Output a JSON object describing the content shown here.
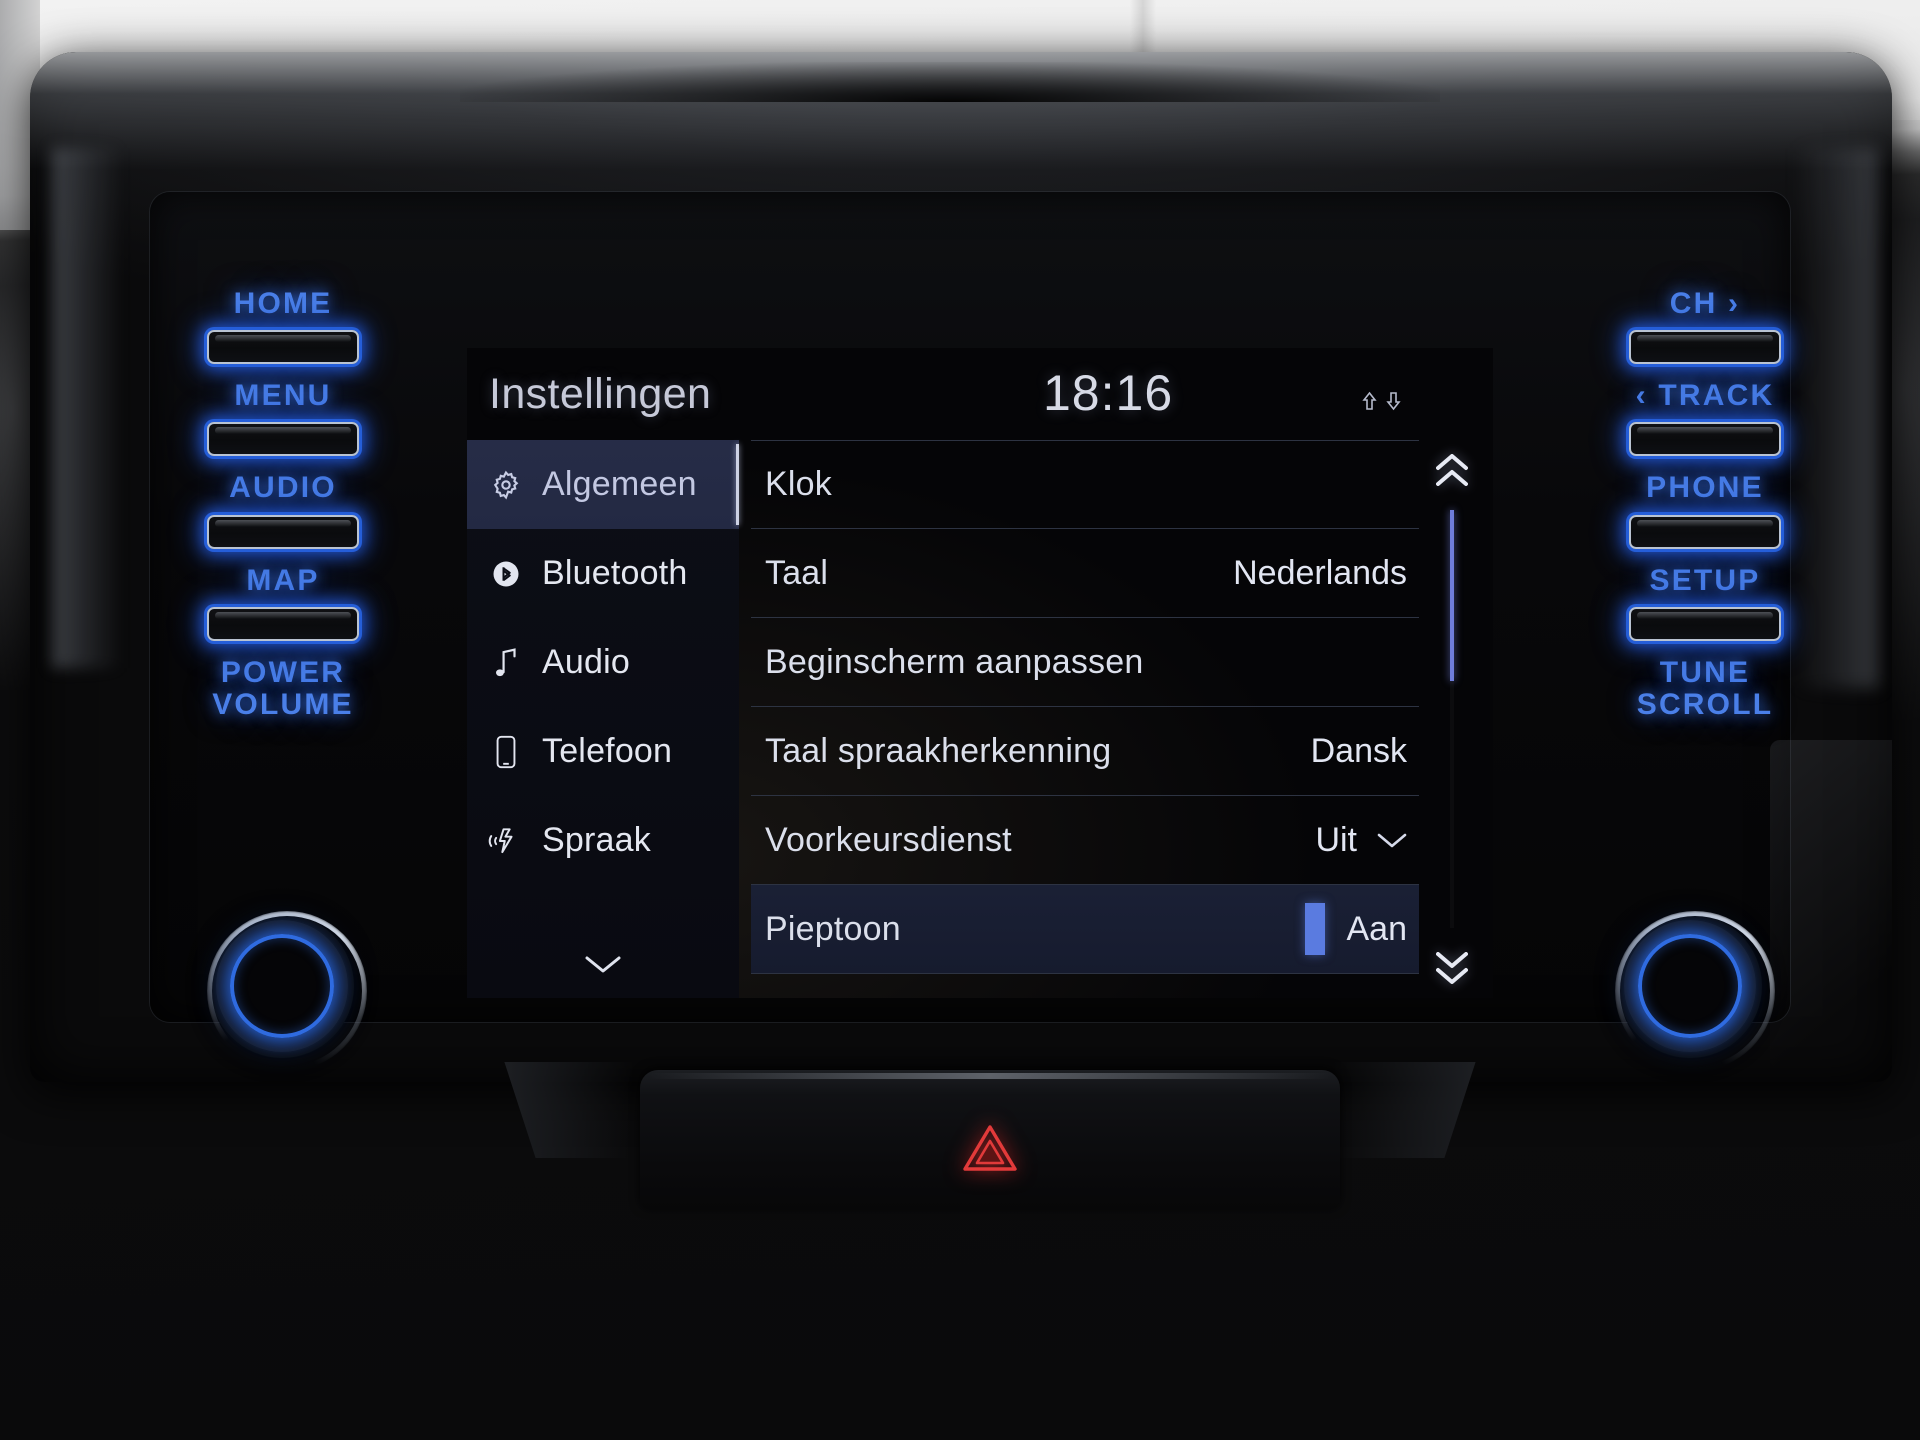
{
  "device": {
    "name": "car-infotainment-head-unit"
  },
  "screen": {
    "header": {
      "title": "Instellingen",
      "clock": "18:16",
      "status_icons": [
        "arrow-up-icon",
        "arrow-down-icon"
      ]
    },
    "sidebar": {
      "items": [
        {
          "label": "Algemeen",
          "icon": "gear-icon",
          "selected": true
        },
        {
          "label": "Bluetooth",
          "icon": "bluetooth-icon",
          "selected": false
        },
        {
          "label": "Audio",
          "icon": "music-note-icon",
          "selected": false
        },
        {
          "label": "Telefoon",
          "icon": "phone-icon",
          "selected": false
        },
        {
          "label": "Spraak",
          "icon": "voice-icon",
          "selected": false
        }
      ],
      "more_icon": "chevron-down-icon"
    },
    "list": {
      "rows": [
        {
          "label": "Klok",
          "value": "",
          "chevron": false,
          "highlight": false
        },
        {
          "label": "Taal",
          "value": "Nederlands",
          "chevron": false,
          "highlight": false
        },
        {
          "label": "Beginscherm aanpassen",
          "value": "",
          "chevron": false,
          "highlight": false
        },
        {
          "label": "Taal spraakherkenning",
          "value": "Dansk",
          "chevron": false,
          "highlight": false
        },
        {
          "label": "Voorkeursdienst",
          "value": "Uit",
          "chevron": true,
          "highlight": false
        },
        {
          "label": "Pieptoon",
          "value": "Aan",
          "chevron": false,
          "highlight": true
        }
      ],
      "scroll": {
        "up_icon": "double-chevron-up-icon",
        "down_icon": "double-chevron-down-icon",
        "thumb_percent": 41
      }
    },
    "colors": {
      "accent_blue": "#5a7be0",
      "selected_row_bg": "#262c47",
      "text_primary": "#e4e7f0"
    }
  },
  "hardware": {
    "left_buttons": [
      {
        "label": "HOME"
      },
      {
        "label": "MENU"
      },
      {
        "label": "AUDIO"
      },
      {
        "label": "MAP"
      }
    ],
    "left_knob": {
      "label": "POWER\nVOLUME"
    },
    "right_buttons": [
      {
        "label": "CH  ›"
      },
      {
        "label": "‹ TRACK"
      },
      {
        "label": "PHONE"
      },
      {
        "label": "SETUP"
      }
    ],
    "right_knob": {
      "label": "TUNE\nSCROLL"
    },
    "hazard": {
      "icon": "hazard-triangle-icon",
      "color": "#e23a3a"
    }
  }
}
